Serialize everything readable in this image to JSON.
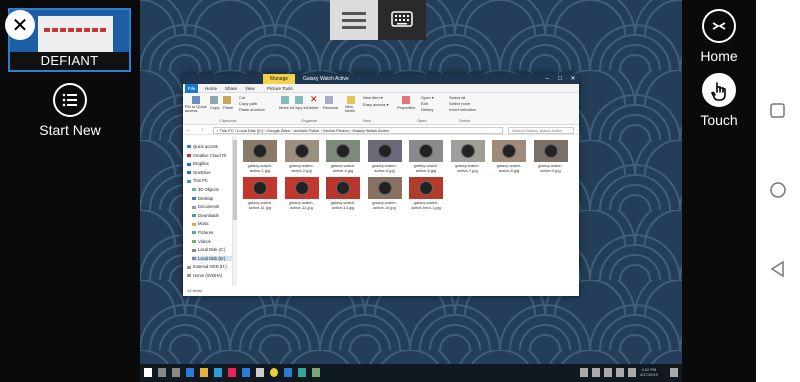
{
  "session": {
    "name": "DEFIANT"
  },
  "left_rail": {
    "start_new_label": "Start New"
  },
  "right_rail": {
    "home_label": "Home",
    "touch_label": "Touch"
  },
  "explorer": {
    "manage_tab": "Manage",
    "window_title": "Galaxy Watch Active",
    "menu": [
      "File",
      "Home",
      "Share",
      "View",
      "Picture Tools"
    ],
    "ribbon": {
      "pin": "Pin to Quick access",
      "copy": "Copy",
      "paste": "Paste",
      "cut": "Cut",
      "copy_path": "Copy path",
      "paste_shortcut": "Paste shortcut",
      "move_to": "Move to",
      "copy_to": "Copy to",
      "delete": "Delete",
      "rename": "Rename",
      "new_folder": "New folder",
      "new_item": "New item ▾",
      "easy_access": "Easy access ▾",
      "properties": "Properties",
      "open": "Open ▾",
      "edit": "Edit",
      "history": "History",
      "select_all": "Select all",
      "select_none": "Select none",
      "invert_selection": "Invert selection",
      "groups": [
        "Clipboard",
        "Organize",
        "New",
        "Open",
        "Select"
      ]
    },
    "address_path": "›  This PC  ›  Local Disk (D:)  ›  Google Drive  ›  Android Police  ›  Device Photos  ›  Galaxy Watch Active",
    "search_placeholder": "Search Galaxy Watch Active",
    "nav_items": [
      "Quick access",
      "Creative Cloud Fil",
      "Dropbox",
      "OneDrive",
      "This PC",
      "3D Objects",
      "Desktop",
      "Documents",
      "Downloads",
      "Music",
      "Pictures",
      "Videos",
      "Local Disk (C:)",
      "Local Disk (D:)",
      "External HDD (H:)",
      "Home (\\\\VDHA("
    ],
    "files": [
      "galaxy-watch-active-1.jpg",
      "galaxy-watch-active-2.jpg",
      "galaxy-watch-active-4.jpg",
      "galaxy-watch-active-5.jpg",
      "galaxy-watch-active-6.jpg",
      "galaxy-watch-active-7.jpg",
      "galaxy-watch-active-8.jpg",
      "galaxy-watch-active-9.jpg",
      "galaxy-watch-active-11.jpg",
      "galaxy-watch-active-12.jpg",
      "galaxy-watch-active-13.jpg",
      "galaxy-watch-active-14.jpg",
      "galaxy-watch-active-hero-1.jpg"
    ],
    "status": "13 items"
  },
  "taskbar": {
    "time": "4:02 PM",
    "date": "4/17/2019"
  },
  "colors": {
    "accent": "#1979ca",
    "desktop": "#243e59",
    "manage": "#f2d24a"
  }
}
